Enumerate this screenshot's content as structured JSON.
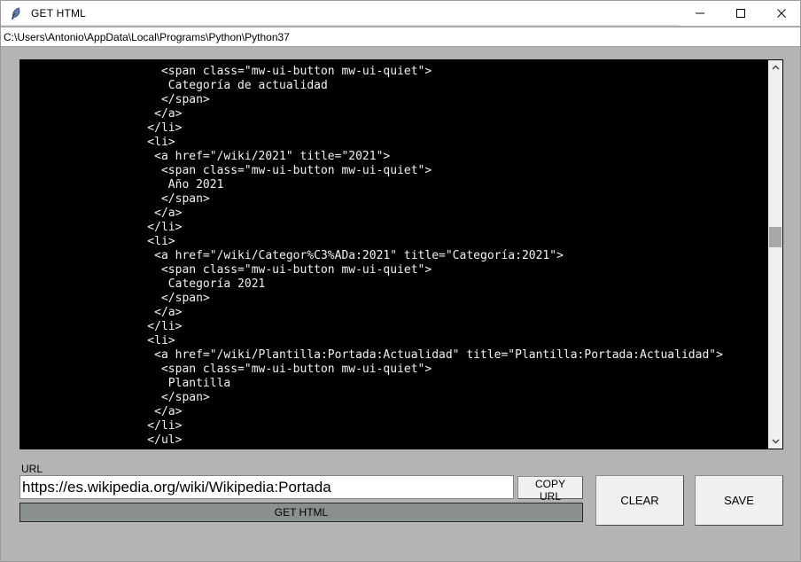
{
  "window": {
    "title": "GET HTML",
    "app_icon": "feather-icon",
    "controls": {
      "minimize": "minimize-icon",
      "maximize": "maximize-icon",
      "close": "close-icon"
    }
  },
  "pathbar": {
    "path": "C:\\Users\\Antonio\\AppData\\Local\\Programs\\Python\\Python37"
  },
  "code_view": {
    "background": "#000000",
    "foreground": "#f2f2f2",
    "lines": [
      "      <span class=\"mw-ui-button mw-ui-quiet\">",
      "       Categoría de actualidad",
      "      </span>",
      "     </a>",
      "    </li>",
      "    <li>",
      "     <a href=\"/wiki/2021\" title=\"2021\">",
      "      <span class=\"mw-ui-button mw-ui-quiet\">",
      "       Año 2021",
      "      </span>",
      "     </a>",
      "    </li>",
      "    <li>",
      "     <a href=\"/wiki/Categor%C3%ADa:2021\" title=\"Categoría:2021\">",
      "      <span class=\"mw-ui-button mw-ui-quiet\">",
      "       Categoría 2021",
      "      </span>",
      "     </a>",
      "    </li>",
      "    <li>",
      "     <a href=\"/wiki/Plantilla:Portada:Actualidad\" title=\"Plantilla:Portada:Actualidad\">",
      "      <span class=\"mw-ui-button mw-ui-quiet\">",
      "       Plantilla",
      "      </span>",
      "     </a>",
      "    </li>",
      "    </ul>"
    ]
  },
  "scrollbar": {
    "up_arrow": "chevron-up-icon",
    "down_arrow": "chevron-down-icon",
    "thumb_position_percent": 45
  },
  "form": {
    "url_label": "URL",
    "url_value": "https://es.wikipedia.org/wiki/Wikipedia:Portada",
    "url_placeholder": "",
    "copy_url_label": "COPY URL",
    "get_html_label": "GET HTML",
    "clear_label": "CLEAR",
    "save_label": "SAVE"
  },
  "colors": {
    "window_background": "#b4b4b4",
    "code_background": "#000000",
    "active_button": "#8a918c",
    "button_face": "#f0f0f0"
  }
}
